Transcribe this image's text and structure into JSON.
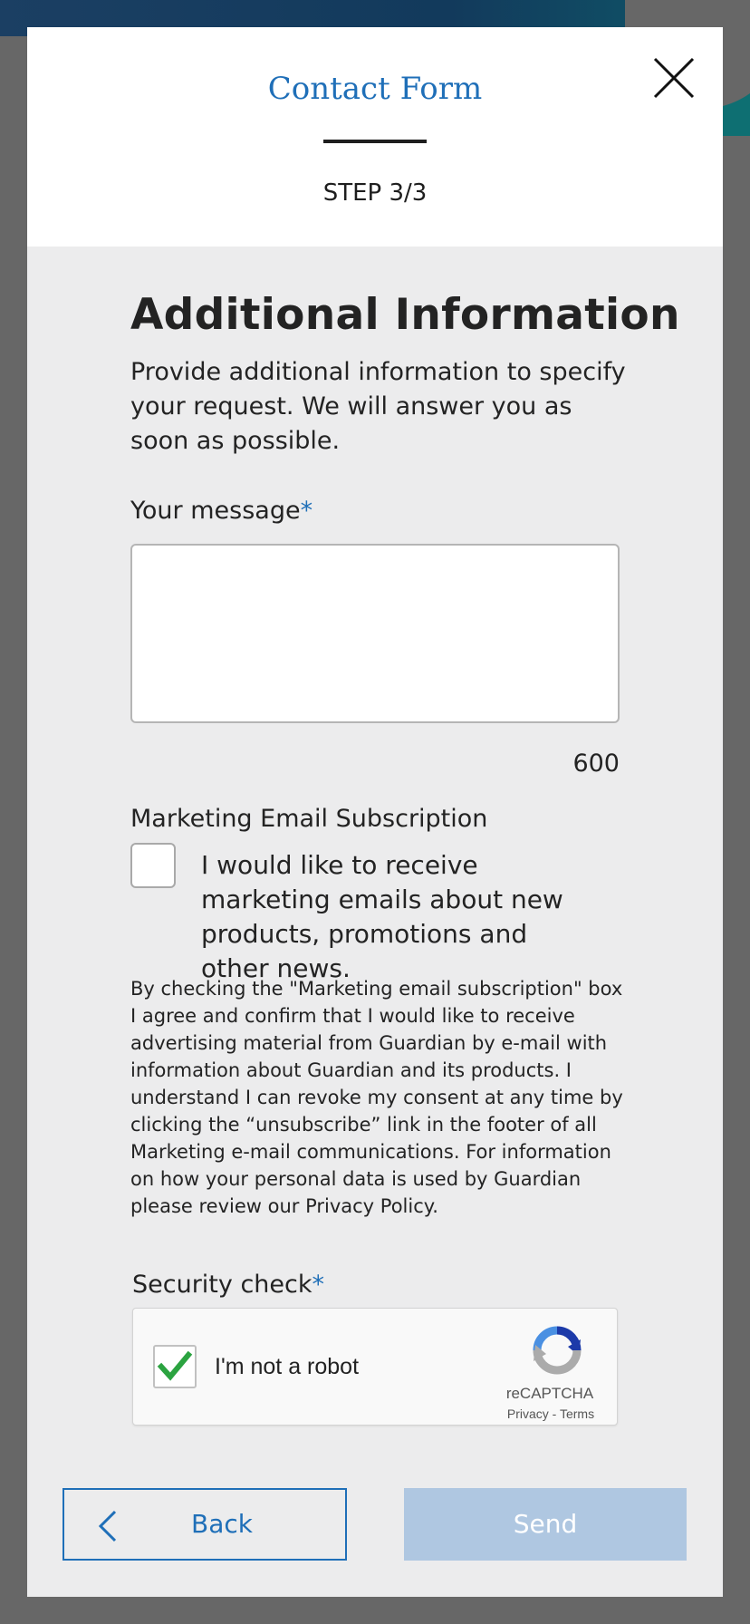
{
  "modal": {
    "title": "Contact Form",
    "step": "STEP 3/3"
  },
  "form": {
    "heading": "Additional Information",
    "intro": "Provide additional information to specify your request. We will answer you as soon as possible.",
    "message_label": "Your message",
    "required_marker": "*",
    "message_value": "",
    "char_count": "600",
    "marketing_label": "Marketing Email Subscription",
    "marketing_checked": false,
    "marketing_text": "I would like to receive marketing emails about new products, promotions and other news.",
    "disclaimer": "By checking the \"Marketing email subscription\" box I agree and confirm that I would like to receive advertising material from Guardian by e-mail with information about Guardian and its products. I understand I can revoke my consent at any time by clicking the “unsubscribe” link in the footer of all Marketing e-mail communications. For information on how your personal data is used by Guardian please review our Privacy Policy.",
    "security_label": "Security check"
  },
  "recaptcha": {
    "label": "I'm not a robot",
    "checked": true,
    "brand": "reCAPTCHA",
    "privacy": "Privacy",
    "separator": " - ",
    "terms": "Terms"
  },
  "buttons": {
    "back": "Back",
    "send": "Send"
  },
  "icons": {
    "close": "close-icon",
    "back": "chevron-left-icon",
    "checkmark": "checkmark-icon",
    "recaptcha_logo": "recaptcha-logo-icon"
  },
  "colors": {
    "accent": "#1f6fb8",
    "send_disabled": "#afc7e1",
    "check_green": "#2ba340",
    "overlay": "#676767",
    "panel": "#ececed"
  }
}
